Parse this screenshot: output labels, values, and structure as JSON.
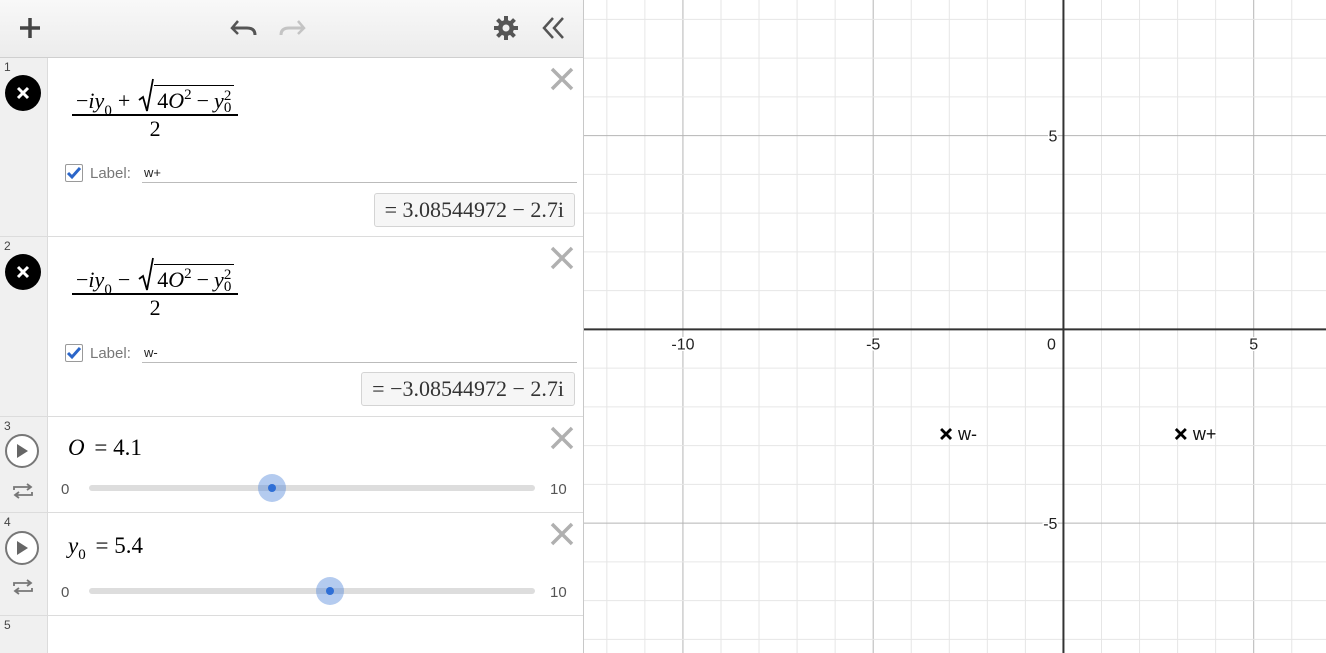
{
  "toolbar": {
    "add_icon": "plus-icon",
    "undo_icon": "undo-icon",
    "redo_icon": "redo-icon",
    "settings_icon": "gear-icon",
    "collapse_icon": "double-chevron-left-icon"
  },
  "expressions": [
    {
      "index": "1",
      "sign": "+",
      "label_checkbox_text": "Label:",
      "label_value": "w+",
      "result": "= 3.08544972 − 2.7i"
    },
    {
      "index": "2",
      "sign": "−",
      "label_checkbox_text": "Label:",
      "label_value": "w-",
      "result": "= −3.08544972 − 2.7i"
    }
  ],
  "formula": {
    "neg_i": "−",
    "i": "i",
    "y": "y",
    "y_sub": "0",
    "four": "4",
    "O": "O",
    "sq": "2",
    "minus": "−",
    "denominator": "2"
  },
  "sliders": [
    {
      "index": "3",
      "var": "O",
      "var_sub": "",
      "eq": "= 4.1",
      "min": "0",
      "max": "10",
      "value": 4.1,
      "range": [
        0,
        10
      ]
    },
    {
      "index": "4",
      "var": "y",
      "var_sub": "0",
      "eq": "= 5.4",
      "min": "0",
      "max": "10",
      "value": 5.4,
      "range": [
        0,
        10
      ]
    }
  ],
  "empty_row": {
    "index": "5"
  },
  "graph": {
    "x_range": [
      -12.6,
      6.9
    ],
    "y_range": [
      -8.35,
      8.5
    ],
    "x_tick_labels": [
      "-10",
      "-5",
      "0",
      "5"
    ],
    "y_tick_labels": [
      "5",
      "-5"
    ],
    "points": [
      {
        "label": "w+",
        "x": 3.085,
        "y": -2.7
      },
      {
        "label": "w-",
        "x": -3.085,
        "y": -2.7
      }
    ],
    "colors": {
      "minor_grid": "#e6e6e6",
      "major_grid": "#b5b5b5",
      "axis": "#333333",
      "point": "#000000"
    }
  }
}
